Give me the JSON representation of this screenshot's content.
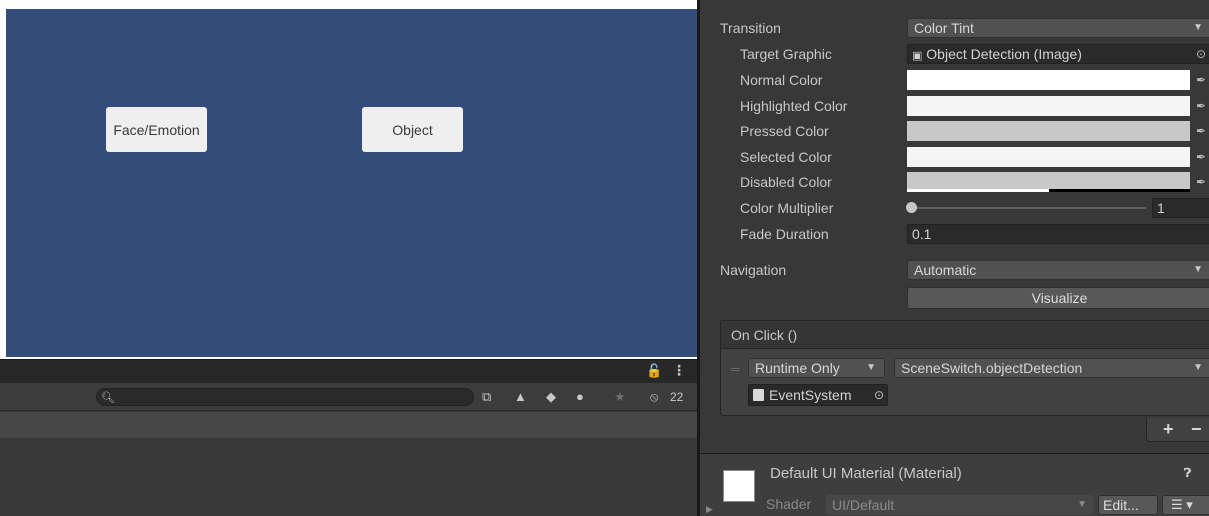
{
  "colors": {
    "scene_bg": "#354d7b",
    "inspector_bg": "#383838",
    "normal_color": "#ffffff",
    "highlighted_color": "#f5f5f5",
    "pressed_color": "#c8c8c8",
    "selected_color": "#f5f5f5",
    "disabled_color": "#c8c8c8"
  },
  "scene": {
    "buttons": [
      {
        "label": "Face/Emotion"
      },
      {
        "label": "Object"
      }
    ]
  },
  "hierarchy": {
    "lock_icon": "lock-icon",
    "search_placeholder": "",
    "hidden_count": "22",
    "toolbar_icons": [
      "scene-visibility-icon",
      "prefab-icon",
      "tag-icon",
      "warning-icon",
      "favorite-star-icon",
      "hidden-eye-icon"
    ]
  },
  "inspector": {
    "transition": {
      "label": "Transition",
      "value": "Color Tint"
    },
    "target_graphic": {
      "label": "Target Graphic",
      "value": "Object Detection (Image)"
    },
    "normal_color": {
      "label": "Normal Color"
    },
    "highlighted_color": {
      "label": "Highlighted Color"
    },
    "pressed_color": {
      "label": "Pressed Color"
    },
    "selected_color": {
      "label": "Selected Color"
    },
    "disabled_color": {
      "label": "Disabled Color",
      "alpha": 0.5
    },
    "color_multiplier": {
      "label": "Color Multiplier",
      "value": "1"
    },
    "fade_duration": {
      "label": "Fade Duration",
      "value": "0.1"
    },
    "navigation": {
      "label": "Navigation",
      "value": "Automatic"
    },
    "visualize_label": "Visualize",
    "on_click": {
      "header": "On Click ()",
      "runtime": "Runtime Only",
      "method": "SceneSwitch.objectDetection",
      "target": "EventSystem"
    },
    "plus_label": "+",
    "minus_label": "−",
    "material": {
      "name": "Default UI Material (Material)",
      "shader_label": "Shader",
      "shader_value": "UI/Default",
      "edit_label": "Edit...",
      "list_label": "☰ ▾"
    }
  }
}
